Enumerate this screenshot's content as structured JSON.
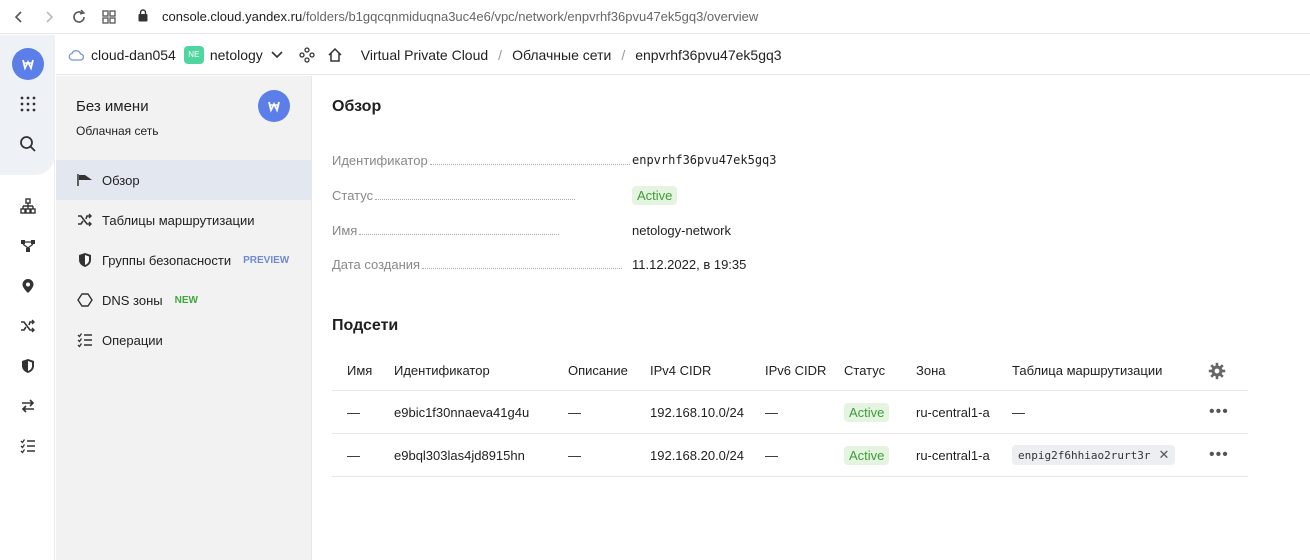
{
  "browser": {
    "url_domain": "console.cloud.yandex.ru",
    "url_path": "/folders/b1gqcqnmiduqna3uc4e6/vpc/network/enpvrhf36pvu47ek5gq3/overview"
  },
  "header": {
    "cloud": "cloud-dan054",
    "folder_badge": "NE",
    "folder": "netology",
    "breadcrumbs": [
      "Virtual Private Cloud",
      "Облачные сети",
      "enpvrhf36pvu47ek5gq3"
    ],
    "separator": "/"
  },
  "panel": {
    "title": "Без имени",
    "subtitle": "Облачная сеть",
    "menu": [
      {
        "label": "Обзор",
        "icon": "flag-icon",
        "active": true,
        "badge": ""
      },
      {
        "label": "Таблицы маршрутизации",
        "icon": "shuffle-icon",
        "active": false,
        "badge": ""
      },
      {
        "label": "Группы безопасности",
        "icon": "shield-icon",
        "active": false,
        "badge": "PREVIEW"
      },
      {
        "label": "DNS зоны",
        "icon": "hexagon-icon",
        "active": false,
        "badge": "NEW"
      },
      {
        "label": "Операции",
        "icon": "checklist-icon",
        "active": false,
        "badge": ""
      }
    ]
  },
  "overview": {
    "heading": "Обзор",
    "props": [
      {
        "label": "Идентификатор",
        "value": "enpvrhf36pvu47ek5gq3"
      },
      {
        "label": "Статус",
        "value": "Active"
      },
      {
        "label": "Имя",
        "value": "netology-network"
      },
      {
        "label": "Дата создания",
        "value": "11.12.2022, в 19:35"
      }
    ]
  },
  "subnets": {
    "heading": "Подсети",
    "columns": [
      "Имя",
      "Идентификатор",
      "Описание",
      "IPv4 CIDR",
      "IPv6 CIDR",
      "Статус",
      "Зона",
      "Таблица маршрутизации"
    ],
    "rows": [
      {
        "name": "—",
        "id": "e9bic1f30nnaeva41g4u",
        "description": "—",
        "ipv4": "192.168.10.0/24",
        "ipv6": "—",
        "status": "Active",
        "zone": "ru-central1-a",
        "route_table": "—"
      },
      {
        "name": "—",
        "id": "e9bql303las4jd8915hn",
        "description": "—",
        "ipv4": "192.168.20.0/24",
        "ipv6": "—",
        "status": "Active",
        "zone": "ru-central1-a",
        "route_table": "enpig2f6hhiao2rurt3r"
      }
    ],
    "more_glyph": "•••",
    "remove_glyph": "✕"
  },
  "colors": {
    "accent": "#5b7ee8",
    "active_bg": "#e4f4e0",
    "active_text": "#3e9b38",
    "panel_bg": "#f2f2f2"
  }
}
